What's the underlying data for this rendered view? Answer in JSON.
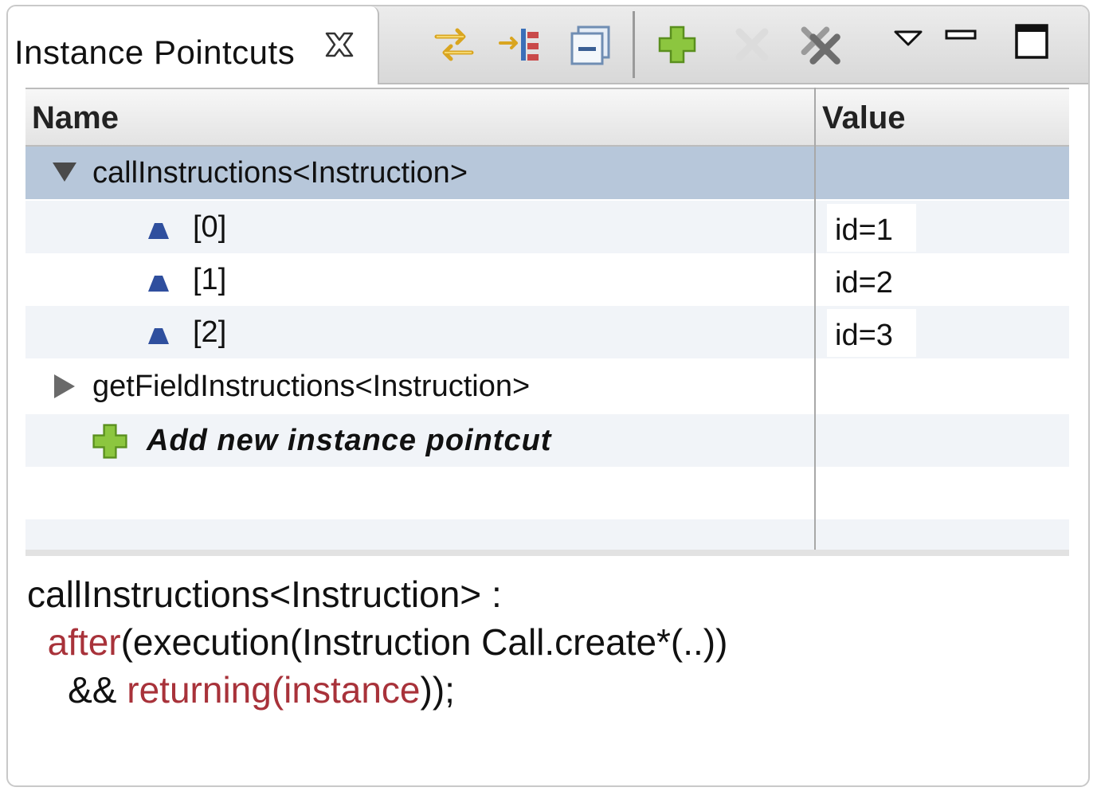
{
  "view": {
    "tab_title": "Instance Pointcuts",
    "toolbar": {
      "icons": [
        "link-with-editor-icon",
        "show-in-editor-icon",
        "collapse-all-icon",
        "add-icon",
        "remove-icon",
        "remove-all-icon",
        "view-menu-icon",
        "minimize-icon",
        "maximize-icon"
      ]
    }
  },
  "table": {
    "columns": [
      "Name",
      "Value"
    ],
    "rows": [
      {
        "name": "callInstructions<Instruction>",
        "value": "",
        "expanded": true
      },
      {
        "name": "[0]",
        "value": "id=1"
      },
      {
        "name": "[1]",
        "value": "id=2"
      },
      {
        "name": "[2]",
        "value": "id=3"
      },
      {
        "name": "getFieldInstructions<Instruction>",
        "value": "",
        "expanded": false
      },
      {
        "name": "Add new instance pointcut",
        "value": ""
      }
    ]
  },
  "detail": {
    "line1": "callInstructions<Instruction> :",
    "line2_kw": "after",
    "line2_rest": "(execution(Instruction Call.create*(..))",
    "line3_pre": "&& ",
    "line3_kw": "returning",
    "line3_paren": "(",
    "line3_kw2": "instance",
    "line3_post": "));"
  },
  "colors": {
    "selection": "#b7c7da",
    "keyword": "#a8323a",
    "accent_green": "#7cbf2a",
    "instance_icon": "#2f4f9e"
  }
}
